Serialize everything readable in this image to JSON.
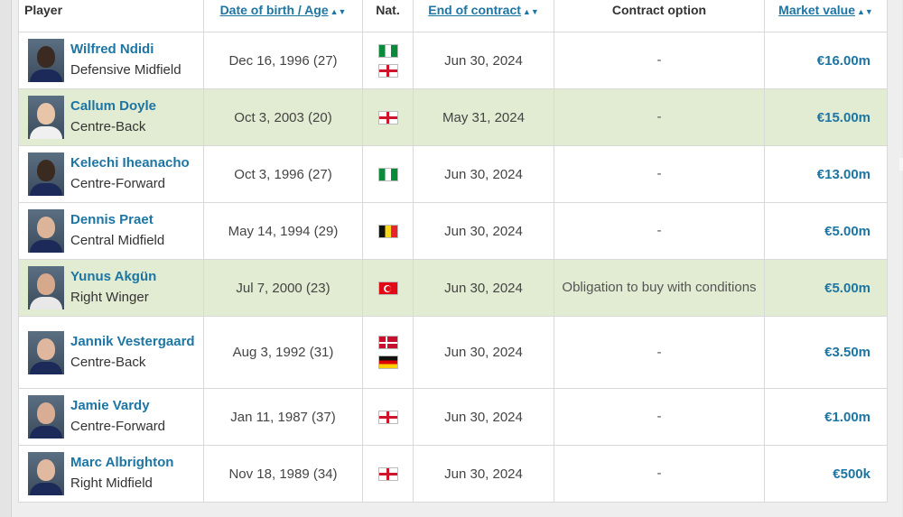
{
  "headers": {
    "player": "Player",
    "dob_age": "Date of birth / Age",
    "nat": "Nat.",
    "end_contract": "End of contract",
    "contract_option": "Contract option",
    "market_value": "Market value"
  },
  "rows": [
    {
      "name": "Wilfred Ndidi",
      "position": "Defensive Midfield",
      "dob": "Dec 16, 1996 (27)",
      "flags": [
        "nigeria-flag",
        "england-flag"
      ],
      "contract": "Jun 30, 2024",
      "option": "-",
      "value": "€16.00m",
      "loan": false,
      "skin": "#3a2a22",
      "kit": "#1c2a5a"
    },
    {
      "name": "Callum Doyle",
      "position": "Centre-Back",
      "dob": "Oct 3, 2003 (20)",
      "flags": [
        "england-flag"
      ],
      "contract": "May 31, 2024",
      "option": "-",
      "value": "€15.00m",
      "loan": true,
      "skin": "#e8c4a8",
      "kit": "#f0f0f0"
    },
    {
      "name": "Kelechi Iheanacho",
      "position": "Centre-Forward",
      "dob": "Oct 3, 1996 (27)",
      "flags": [
        "nigeria-flag"
      ],
      "contract": "Jun 30, 2024",
      "option": "-",
      "value": "€13.00m",
      "loan": false,
      "skin": "#3b2a20",
      "kit": "#1c2a5a"
    },
    {
      "name": "Dennis Praet",
      "position": "Central Midfield",
      "dob": "May 14, 1994 (29)",
      "flags": [
        "belgium-flag"
      ],
      "contract": "Jun 30, 2024",
      "option": "-",
      "value": "€5.00m",
      "loan": false,
      "skin": "#dcb49a",
      "kit": "#1c2a5a"
    },
    {
      "name": "Yunus Akgün",
      "position": "Right Winger",
      "dob": "Jul 7, 2000 (23)",
      "flags": [
        "turkey-flag"
      ],
      "contract": "Jun 30, 2024",
      "option": "Obligation to buy with conditions",
      "value": "€5.00m",
      "loan": true,
      "skin": "#d6a98c",
      "kit": "#e8e8e8"
    },
    {
      "name": "Jannik Vestergaard",
      "position": "Centre-Back",
      "dob": "Aug 3, 1992 (31)",
      "flags": [
        "denmark-flag",
        "germany-flag"
      ],
      "contract": "Jun 30, 2024",
      "option": "-",
      "value": "€3.50m",
      "loan": false,
      "skin": "#dfb79e",
      "kit": "#1c2a5a"
    },
    {
      "name": "Jamie Vardy",
      "position": "Centre-Forward",
      "dob": "Jan 11, 1987 (37)",
      "flags": [
        "england-flag"
      ],
      "contract": "Jun 30, 2024",
      "option": "-",
      "value": "€1.00m",
      "loan": false,
      "skin": "#d9ad94",
      "kit": "#1c2a5a"
    },
    {
      "name": "Marc Albrighton",
      "position": "Right Midfield",
      "dob": "Nov 18, 1989 (34)",
      "flags": [
        "england-flag"
      ],
      "contract": "Jun 30, 2024",
      "option": "-",
      "value": "€500k",
      "loan": false,
      "skin": "#e0b9a0",
      "kit": "#1c2a5a"
    }
  ]
}
